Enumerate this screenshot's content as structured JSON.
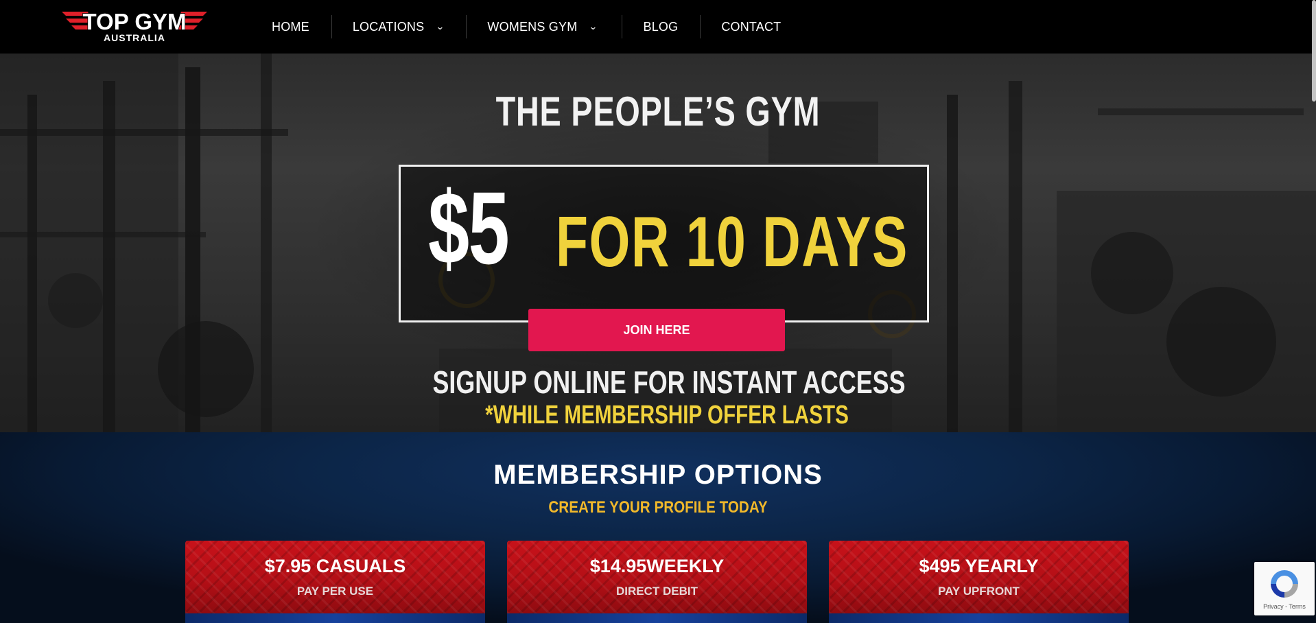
{
  "logo": {
    "line1": "TOP GYM",
    "line2": "AUSTRALIA"
  },
  "nav": {
    "home": "HOME",
    "locations": "LOCATIONS",
    "womens_gym": "WOMENS GYM",
    "blog": "BLOG",
    "contact": "CONTACT",
    "dropdown_icon": "chevron-down-icon"
  },
  "hero": {
    "title": "THE PEOPLE’S GYM",
    "price": "$5",
    "offer": "FOR 10 DAYS",
    "cta": "JOIN HERE",
    "signup": "SIGNUP ONLINE FOR INSTANT ACCESS",
    "note": "*WHILE MEMBERSHIP OFFER LASTS"
  },
  "membership": {
    "title": "MEMBERSHIP OPTIONS",
    "subtitle": "CREATE YOUR PROFILE TODAY",
    "cards": [
      {
        "title": "$7.95 CASUALS",
        "subtitle": "PAY PER USE"
      },
      {
        "title": "$14.95WEEKLY",
        "subtitle": "DIRECT DEBIT"
      },
      {
        "title": "$495 YEARLY",
        "subtitle": "PAY UPFRONT"
      }
    ]
  },
  "recaptcha": {
    "links": "Privacy - Terms",
    "icon": "recaptcha-icon"
  },
  "colors": {
    "accent_pink": "#e2174f",
    "offer_yellow": "#f0d23c",
    "subtitle_gold": "#f2b92a",
    "card_red": "#c8121a",
    "section_navy": "#0c2547"
  }
}
